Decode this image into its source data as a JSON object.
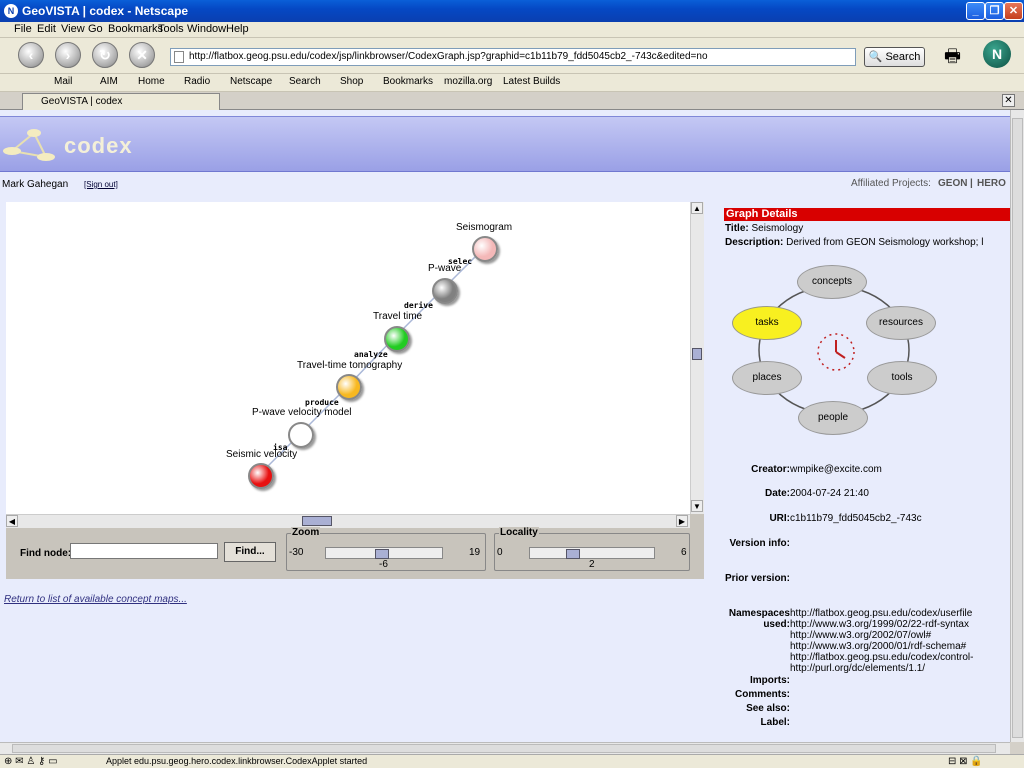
{
  "window": {
    "title": "GeoVISTA | codex - Netscape"
  },
  "menu": [
    "File",
    "Edit",
    "View",
    "Go",
    "Bookmarks",
    "Tools",
    "Window",
    "Help"
  ],
  "nav": {
    "url": "http://flatbox.geog.psu.edu/codex/jsp/linkbrowser/CodexGraph.jsp?graphid=c1b11b79_fdd5045cb2_-743c&edited=no",
    "search_label": "Search"
  },
  "personal": [
    "Mail",
    "AIM",
    "Home",
    "Radio",
    "Netscape",
    "Search",
    "Shop",
    "Bookmarks",
    "mozilla.org",
    "Latest Builds"
  ],
  "tab": {
    "label": "GeoVISTA | codex"
  },
  "banner": {
    "logo": "codex"
  },
  "user": {
    "name": "Mark Gahegan",
    "signout": "[Sign out]",
    "affiliated_label": "Affiliated Projects:",
    "projects": [
      "GEON",
      "HERO"
    ],
    "sep": "|"
  },
  "graph": {
    "nodes": [
      {
        "label": "Seismogram",
        "color": "#f4b8b8"
      },
      {
        "label": "P-wave",
        "color": "#808080"
      },
      {
        "label": "Travel time",
        "color": "#22cc22"
      },
      {
        "label": "Travel-time tomography",
        "color": "#f8b820"
      },
      {
        "label": "P-wave velocity model",
        "color": "#ffffff"
      },
      {
        "label": "Seismic velocity",
        "color": "#e81010"
      }
    ],
    "edges": [
      "selec",
      "derive",
      "analyze",
      "produce",
      "isa"
    ]
  },
  "controls": {
    "find_label": "Find node:",
    "find_button": "Find...",
    "zoom": {
      "label": "Zoom",
      "min": "-30",
      "max": "19",
      "value": "-6",
      "fraction": 0.48
    },
    "locality": {
      "label": "Locality",
      "min": "0",
      "max": "6",
      "value": "2",
      "fraction": 0.33
    }
  },
  "return_link": "Return to list of available concept maps...",
  "details": {
    "header": "Graph Details",
    "title_label": "Title:",
    "title": "Seismology",
    "desc_label": "Description:",
    "desc": "Derived from GEON Seismology workshop; l",
    "wheel": [
      "concepts",
      "resources",
      "tools",
      "people",
      "places",
      "tasks"
    ],
    "wheel_active": "tasks",
    "creator_label": "Creator:",
    "creator": "wmpike@excite.com",
    "date_label": "Date:",
    "date": "2004-07-24 21:40",
    "uri_label": "URI:",
    "uri": "c1b11b79_fdd5045cb2_-743c",
    "version_label": "Version info:",
    "prior_label": "Prior version:",
    "ns_label": "Namespaces used:",
    "namespaces": [
      "http://flatbox.geog.psu.edu/codex/userfile",
      "http://www.w3.org/1999/02/22-rdf-syntax",
      "http://www.w3.org/2002/07/owl#",
      "http://www.w3.org/2000/01/rdf-schema#",
      "http://flatbox.geog.psu.edu/codex/control-",
      "http://purl.org/dc/elements/1.1/"
    ],
    "imports_label": "Imports:",
    "comments_label": "Comments:",
    "seealso_label": "See also:",
    "label_label": "Label:"
  },
  "status": {
    "text": "Applet edu.psu.geog.hero.codex.linkbrowser.CodexApplet started"
  }
}
